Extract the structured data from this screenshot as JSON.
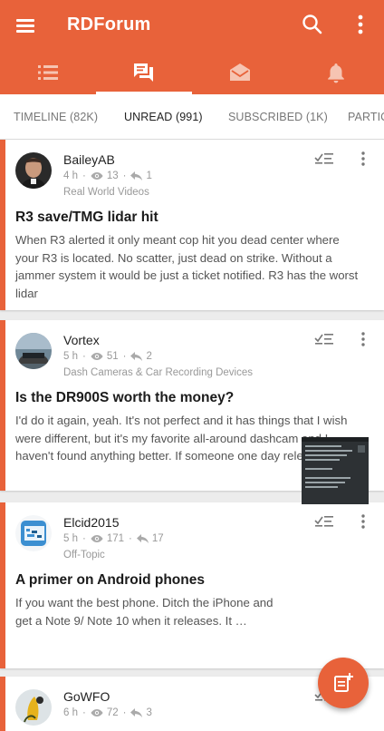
{
  "app": {
    "title": "RDForum"
  },
  "icon_tabs": [
    {
      "name": "list-icon"
    },
    {
      "name": "forum-icon",
      "active": true
    },
    {
      "name": "inbox-icon"
    },
    {
      "name": "bell-icon"
    }
  ],
  "tabs": [
    {
      "label": "TIMELINE (82K)"
    },
    {
      "label": "UNREAD (991)",
      "active": true
    },
    {
      "label": "SUBSCRIBED (1K)"
    },
    {
      "label": "PARTIC"
    }
  ],
  "posts": [
    {
      "author": "BaileyAB",
      "time": "4 h",
      "views": "13",
      "replies": "1",
      "forum": "Real World Videos",
      "title": "R3 save/TMG lidar hit",
      "excerpt": "When R3 alerted it only meant cop hit you dead center where your R3 is located. No scatter, just dead on strike. Without a jammer system it would be just a ticket notified. R3 has the worst lidar"
    },
    {
      "author": "Vortex",
      "time": "5 h",
      "views": "51",
      "replies": "2",
      "forum": "Dash Cameras & Car Recording Devices",
      "title": "Is the DR900S worth the money?",
      "excerpt": "I'd do it again, yeah. It's not perfect and it has things that I wish were different, but it's my favorite all-around dashcam and I haven't found anything better. If someone one day releases a"
    },
    {
      "author": "Elcid2015",
      "time": "5 h",
      "views": "171",
      "replies": "17",
      "forum": "Off-Topic",
      "title": "A primer on Android phones",
      "excerpt": "If you want the best phone. Ditch the iPhone and get a Note 9/ Note 10 when it releases. It …"
    },
    {
      "author": "GoWFO",
      "time": "6 h",
      "views": "72",
      "replies": "3"
    }
  ],
  "colors": {
    "accent": "#e8623a",
    "background": "#ececec"
  }
}
